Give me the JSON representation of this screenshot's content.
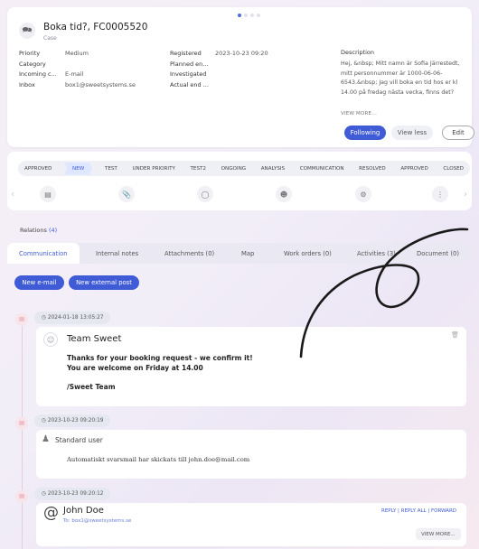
{
  "case": {
    "title": "Boka tid?, FC0005520",
    "type": "Case",
    "priority_label": "Priority",
    "priority": "Medium",
    "category_label": "Category",
    "category": "",
    "incoming_label": "Incoming c...",
    "incoming": "E-mail",
    "inbox_label": "Inbox",
    "inbox": "box1@sweetsystems.se",
    "registered_label": "Registered",
    "registered": "2023-10-23 09:20",
    "planned_label": "Planned en...",
    "investigated_label": "Investigated",
    "actual_label": "Actual end ...",
    "description_label": "Description",
    "description": "Hej, &nbsp; Mitt namn är Sofia Järrestedt, mitt personnummer är 1000-06-06-6543.&nbsp; Jag vill boka en tid hos er kl 14.00 på fredag nästa vecka, finns det?",
    "view_more": "VIEW MORE...",
    "following": "Following",
    "view_less": "View less",
    "edit": "Edit"
  },
  "status_steps": [
    "APPROVED",
    "NEW",
    "TEST",
    "UNDER PRIORITY",
    "TEST2",
    "ONGOING",
    "ANALYSIS",
    "COMMUNICATION",
    "RESOLVED",
    "APPROVED",
    "CLOSED"
  ],
  "current_step_index": 1,
  "relations": {
    "label": "Relations",
    "count": "(4)"
  },
  "tabs": [
    "Communication",
    "Internal notes",
    "Attachments (0)",
    "Map",
    "Work orders (0)",
    "Activities (3)",
    "Document (0)"
  ],
  "buttons": {
    "new_email": "New e-mail",
    "new_external_post": "New external post"
  },
  "timeline": [
    {
      "time": "2024-01-18 13:05:27",
      "sender": "Team Sweet",
      "line1": "Thanks for your booking request - we confirm it!",
      "line2": "You are welcome on Friday at 14.00",
      "sign": "/Sweet Team"
    },
    {
      "time": "2023-10-23 09:20:19",
      "sender": "Standard user",
      "body": "Automatiskt svarsmail har skickats till john.doe@mail.com"
    },
    {
      "time": "2023-10-23 09:20:12",
      "sender": "John Doe",
      "to": "To: box1@sweetsystems.se",
      "actions": "REPLY | REPLY ALL | FORWARD",
      "view_more": "VIEW MORE..."
    }
  ],
  "colors": {
    "accent": "#3f5bd6",
    "timeline_mark": "#e07b92"
  }
}
